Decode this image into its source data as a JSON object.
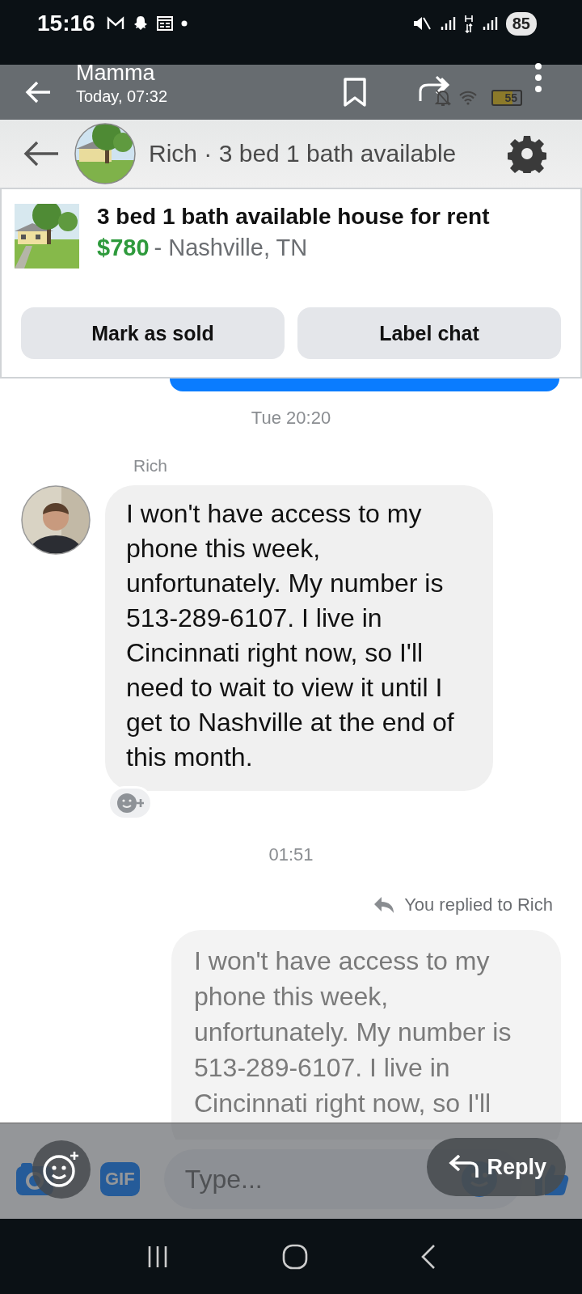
{
  "status_bar": {
    "time": "15:16",
    "battery": "85"
  },
  "viewer": {
    "title": "Mamma",
    "subtitle": "Today, 07:32",
    "inner_battery": "55"
  },
  "chat_header": {
    "title": "Rich · 3 bed 1 bath available"
  },
  "listing": {
    "title": "3 bed 1 bath available house for rent",
    "price": "$780",
    "location": "- Nashville, TN",
    "buttons": [
      "Mark as sold",
      "Label chat"
    ]
  },
  "messages": [
    {
      "kind": "timestamp",
      "text": "Tue 20:20"
    },
    {
      "kind": "incoming",
      "sender": "Rich",
      "text": "I won't have access to my phone this week, unfortunately. My number is 513-289-6107. I live in Cincinnati right now, so I'll need to wait to view it until I get to Nashville at the end of this month."
    },
    {
      "kind": "timestamp",
      "text": "01:51"
    },
    {
      "kind": "outgoing_reply",
      "reply_note": "You replied to Rich",
      "text": "I won't have access to my phone this week, unfortunately. My number is 513-289-6107. I live in Cincinnati right now, so I'll"
    }
  ],
  "composer": {
    "placeholder": "Type...",
    "gif": "GIF"
  },
  "reply_button": {
    "label": "Reply"
  }
}
